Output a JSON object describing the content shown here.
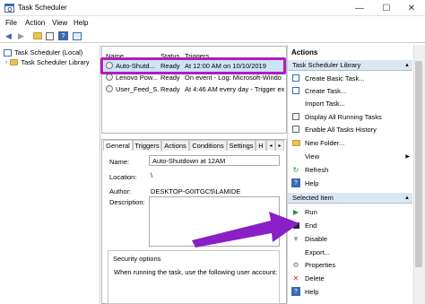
{
  "window": {
    "title": "Task Scheduler",
    "minimize": "—",
    "maximize": "☐",
    "close": "✕"
  },
  "menu": [
    "File",
    "Action",
    "View",
    "Help"
  ],
  "toolbar": [
    "back-icon",
    "forward-icon",
    "folder-icon",
    "properties-icon",
    "help-icon",
    "panel-icon"
  ],
  "tree": {
    "root": "Task Scheduler (Local)",
    "child": "Task Scheduler Library"
  },
  "task_list": {
    "headers": [
      "Name",
      "Status",
      "Triggers"
    ],
    "rows": [
      {
        "name": "Auto-Shutd...",
        "status": "Ready",
        "triggers": "At 12:00 AM on 10/10/2019"
      },
      {
        "name": "Lenovo Pow...",
        "status": "Ready",
        "triggers": "On event - Log: Microsoft-Windo"
      },
      {
        "name": "User_Feed_S...",
        "status": "Ready",
        "triggers": "At 4:46 AM every day - Trigger exp"
      }
    ]
  },
  "tabs": [
    "General",
    "Triggers",
    "Actions",
    "Conditions",
    "Settings",
    "H"
  ],
  "general": {
    "name_label": "Name:",
    "name_value": "Auto-Shutdown at 12AM",
    "location_label": "Location:",
    "location_value": "\\",
    "author_label": "Author:",
    "author_value": "DESKTOP-G0ITGC5\\LAMIDE",
    "description_label": "Description:",
    "security_title": "Security options",
    "security_text": "When running the task, use the following user account:"
  },
  "actions_pane": {
    "title": "Actions",
    "section1": "Task Scheduler Library",
    "items1": [
      {
        "label": "Create Basic Task...",
        "icon": "task-wand-icon"
      },
      {
        "label": "Create Task...",
        "icon": "task-icon"
      },
      {
        "label": "Import Task...",
        "icon": "import-icon"
      },
      {
        "label": "Display All Running Tasks",
        "icon": "list-icon"
      },
      {
        "label": "Enable All Tasks History",
        "icon": "history-icon"
      },
      {
        "label": "New Folder...",
        "icon": "folder-icon"
      },
      {
        "label": "View",
        "icon": "view-icon"
      },
      {
        "label": "Refresh",
        "icon": "refresh-icon"
      },
      {
        "label": "Help",
        "icon": "help-icon"
      }
    ],
    "section2": "Selected Item",
    "items2": [
      {
        "label": "Run",
        "icon": "play-icon"
      },
      {
        "label": "End",
        "icon": "stop-icon"
      },
      {
        "label": "Disable",
        "icon": "disable-icon"
      },
      {
        "label": "Export...",
        "icon": "export-icon"
      },
      {
        "label": "Properties",
        "icon": "properties-icon"
      },
      {
        "label": "Delete",
        "icon": "delete-icon"
      },
      {
        "label": "Help",
        "icon": "help-icon"
      }
    ]
  },
  "colors": {
    "highlight": "#b31bbf",
    "arrow": "#8a1fc6",
    "selection": "#cce4f7"
  }
}
